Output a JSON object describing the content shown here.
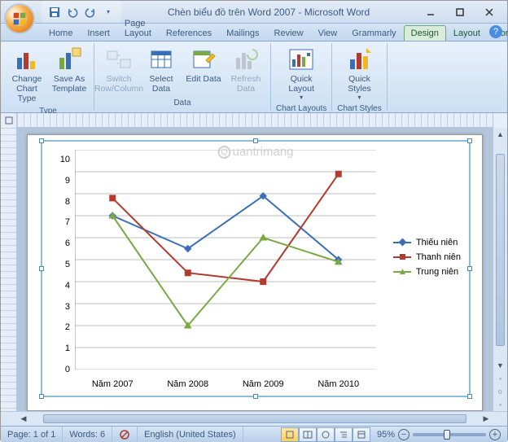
{
  "title": "Chèn biểu đồ trên Word 2007 - Microsoft Word",
  "tabs": {
    "home": "Home",
    "insert": "Insert",
    "page_layout": "Page Layout",
    "references": "References",
    "mailings": "Mailings",
    "review": "Review",
    "view": "View",
    "grammarly": "Grammarly",
    "design": "Design",
    "layout": "Layout",
    "format": "Format"
  },
  "ribbon": {
    "type": {
      "label": "Type",
      "change_chart_type": "Change Chart Type",
      "save_as_template": "Save As Template"
    },
    "data": {
      "label": "Data",
      "switch": "Switch Row/Column",
      "select": "Select Data",
      "edit": "Edit Data",
      "refresh": "Refresh Data"
    },
    "chart_layouts": {
      "label": "Chart Layouts",
      "quick_layout": "Quick Layout"
    },
    "chart_styles": {
      "label": "Chart Styles",
      "quick_styles": "Quick Styles"
    }
  },
  "status": {
    "page": "Page: 1 of 1",
    "words": "Words: 6",
    "language": "English (United States)",
    "zoom": "95%"
  },
  "watermark": "uantrimang",
  "chart_data": {
    "type": "line",
    "categories": [
      "Năm 2007",
      "Năm 2008",
      "Năm 2009",
      "Năm 2010"
    ],
    "series": [
      {
        "name": "Thiếu niên",
        "color": "#3a6fb7",
        "marker": "diamond",
        "values": [
          7,
          5.5,
          7.9,
          5
        ]
      },
      {
        "name": "Thanh niên",
        "color": "#b23a2e",
        "marker": "square",
        "values": [
          7.8,
          4.4,
          4,
          8.9
        ]
      },
      {
        "name": "Trung niên",
        "color": "#7aa843",
        "marker": "triangle",
        "values": [
          7,
          2,
          6,
          4.9
        ]
      }
    ],
    "ylim": [
      0,
      10
    ],
    "ytick_step": 1
  }
}
